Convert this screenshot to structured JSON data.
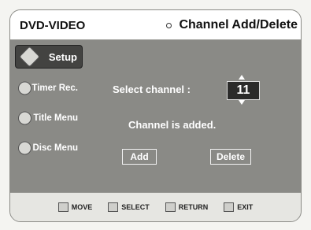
{
  "header": {
    "disc_type": "DVD-VIDEO",
    "menu_title": "Channel Add/Delete"
  },
  "sidebar": {
    "items": [
      {
        "label": "Setup",
        "icon": "setup-icon",
        "active": true
      },
      {
        "label": "Timer Rec.",
        "icon": "timer-rec-icon",
        "active": false
      },
      {
        "label": "Title Menu",
        "icon": "title-menu-icon",
        "active": false
      },
      {
        "label": "Disc Menu",
        "icon": "disc-menu-icon",
        "active": false
      }
    ]
  },
  "main": {
    "select_label": "Select channel :",
    "channel_value": "11",
    "status": "Channel is added.",
    "add_label": "Add",
    "delete_label": "Delete"
  },
  "footer": {
    "move": "MOVE",
    "select": "SELECT",
    "return": "RETURN",
    "exit": "EXIT"
  }
}
